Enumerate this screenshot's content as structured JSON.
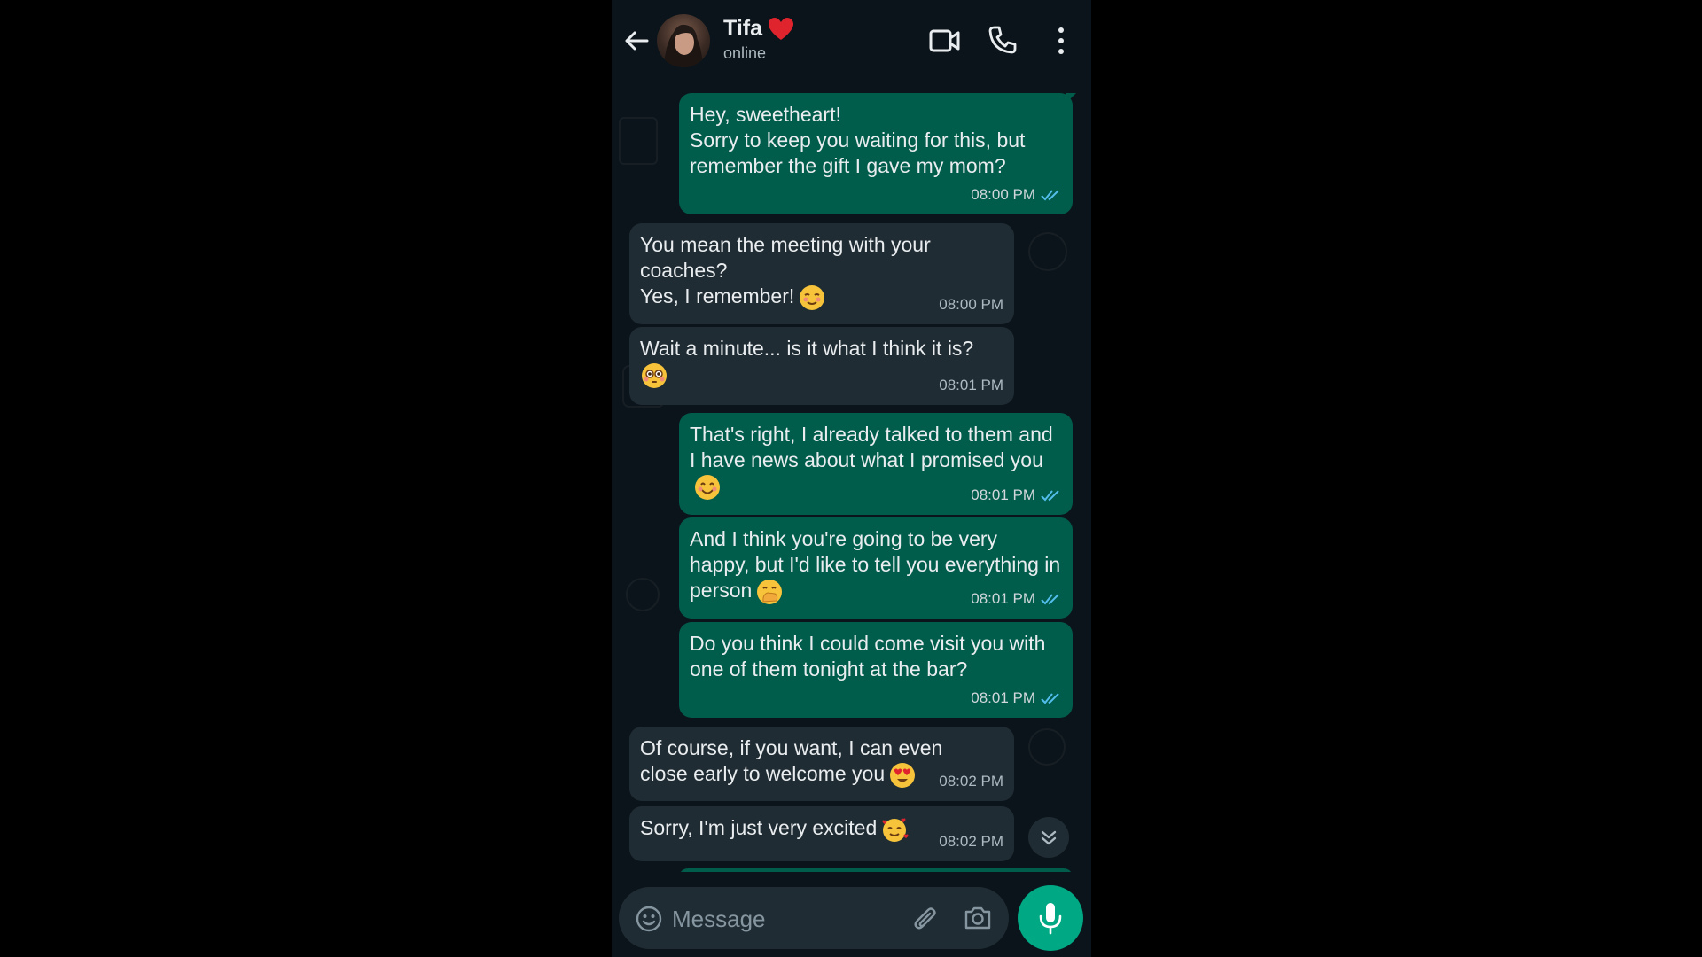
{
  "header": {
    "contact_name": "Tifa",
    "contact_status": "online",
    "icons": [
      "back-arrow-icon",
      "avatar",
      "heart-icon",
      "video-call-icon",
      "phone-icon",
      "more-vert-icon"
    ]
  },
  "messages": [
    {
      "direction": "out",
      "text": "Hey, sweetheart!\nSorry to keep you waiting for this, but remember the gift I gave my mom?",
      "time": "08:00 PM",
      "read": true
    },
    {
      "direction": "in",
      "text": "You mean the meeting with your coaches?\nYes, I remember!",
      "emoji": "relieved-face",
      "time": "08:00 PM"
    },
    {
      "direction": "in",
      "text": "Wait a minute... is it what I think it is?",
      "emoji": "flushed-face",
      "time": "08:01 PM"
    },
    {
      "direction": "out",
      "text": "That's right, I already talked to them and I have news about what I promised you",
      "emoji": "smiling-face",
      "time": "08:01 PM",
      "read": true
    },
    {
      "direction": "out",
      "text": "And I think you're going to be very happy, but I'd like to tell you everything in person",
      "emoji": "hand-over-mouth-face",
      "time": "08:01 PM",
      "read": true
    },
    {
      "direction": "out",
      "text": "Do you think I could come visit you with one of them tonight at the bar?",
      "time": "08:01 PM",
      "read": true
    },
    {
      "direction": "in",
      "text": "Of course, if you want, I can even close early to welcome you",
      "emoji": "heart-eyes-face",
      "time": "08:02 PM"
    },
    {
      "direction": "in",
      "text": "Sorry, I'm just very excited",
      "emoji": "smiling-face-with-hearts",
      "time": "08:02 PM"
    }
  ],
  "composer": {
    "placeholder": "Message",
    "value": ""
  },
  "colors": {
    "background": "#0b141a",
    "outgoing_bubble": "#005c4b",
    "incoming_bubble": "#202c33",
    "accent": "#00a884",
    "read_ticks": "#53bdeb"
  }
}
